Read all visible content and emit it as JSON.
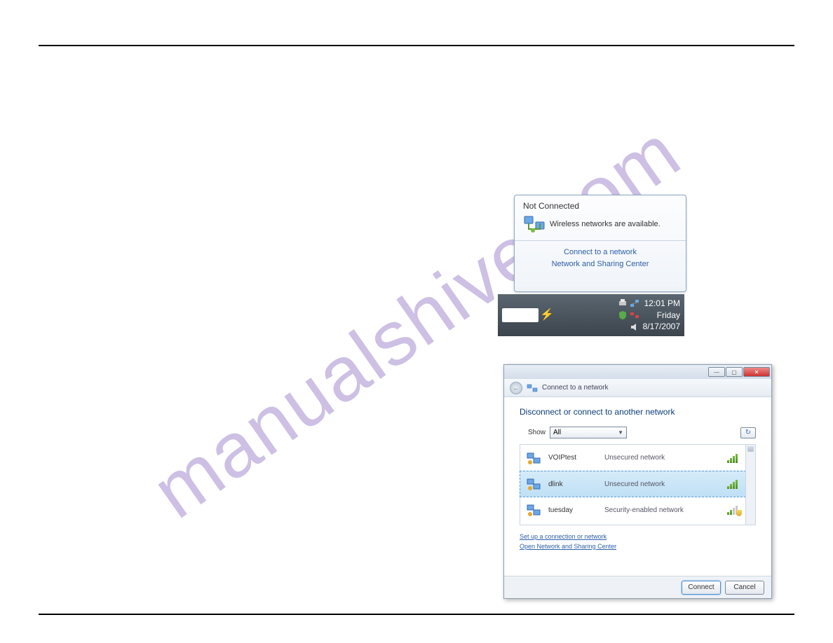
{
  "watermark": "manualshive.com",
  "popup": {
    "title": "Not Connected",
    "message": "Wireless networks are available.",
    "link_connect": "Connect to a network",
    "link_center": "Network and Sharing Center"
  },
  "taskbar": {
    "time": "12:01 PM",
    "day": "Friday",
    "date": "8/17/2007"
  },
  "dialog": {
    "header": "Connect to a network",
    "heading": "Disconnect or connect to another network",
    "show_label": "Show",
    "show_value": "All",
    "networks": [
      {
        "name": "VOIPtest",
        "security": "Unsecured network",
        "selected": false,
        "shielded": false,
        "weak": false
      },
      {
        "name": "dlink",
        "security": "Unsecured network",
        "selected": true,
        "shielded": false,
        "weak": false
      },
      {
        "name": "tuesday",
        "security": "Security-enabled network",
        "selected": false,
        "shielded": true,
        "weak": true
      }
    ],
    "link_setup": "Set up a connection or network",
    "link_open": "Open Network and Sharing Center",
    "btn_connect": "Connect",
    "btn_cancel": "Cancel"
  }
}
